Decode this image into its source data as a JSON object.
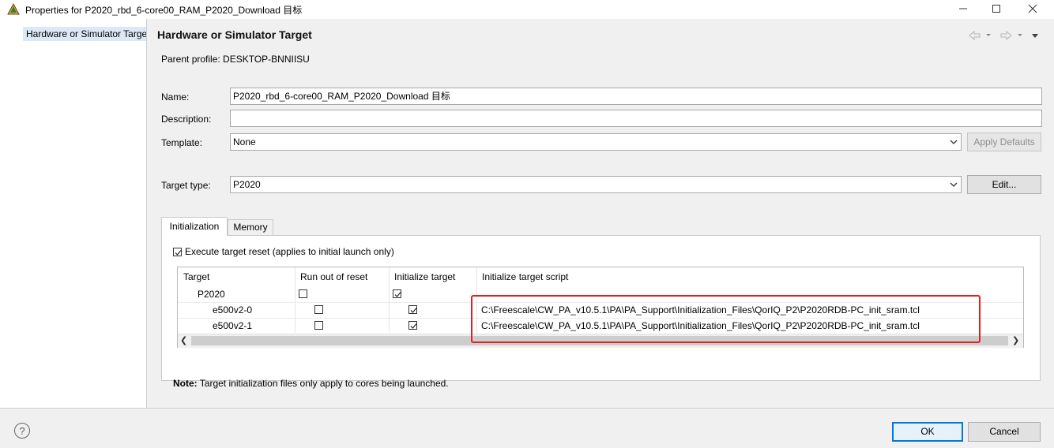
{
  "window": {
    "title": "Properties for P2020_rbd_6-core00_RAM_P2020_Download 目标",
    "min_glyph": "—",
    "max_glyph": "☐",
    "close_glyph": "✕"
  },
  "sidebar": {
    "items": [
      {
        "label": "Hardware or Simulator Target"
      }
    ]
  },
  "page": {
    "title": "Hardware or Simulator Target",
    "parent_profile": "Parent profile: DESKTOP-BNNIISU"
  },
  "form": {
    "name_label": "Name:",
    "name_value": "P2020_rbd_6-core00_RAM_P2020_Download 目标",
    "description_label": "Description:",
    "description_value": "",
    "template_label": "Template:",
    "template_value": "None",
    "apply_defaults_label": "Apply Defaults",
    "target_type_label": "Target type:",
    "target_type_value": "P2020",
    "edit_label": "Edit..."
  },
  "tabs": [
    {
      "label": "Initialization",
      "active": true
    },
    {
      "label": "Memory",
      "active": false
    }
  ],
  "init": {
    "execute_reset_label": "Execute target reset (applies to initial launch only)",
    "execute_reset_checked": true,
    "columns": [
      "Target",
      "Run out of reset",
      "Initialize target",
      "Initialize target script"
    ],
    "rows": [
      {
        "target": "P2020",
        "run_out_of_reset": false,
        "initialize": true,
        "script": ""
      },
      {
        "target": "e500v2-0",
        "run_out_of_reset": false,
        "initialize": true,
        "script": "C:\\Freescale\\CW_PA_v10.5.1\\PA\\PA_Support\\Initialization_Files\\QorIQ_P2\\P2020RDB-PC_init_sram.tcl"
      },
      {
        "target": "e500v2-1",
        "run_out_of_reset": false,
        "initialize": true,
        "script": "C:\\Freescale\\CW_PA_v10.5.1\\PA\\PA_Support\\Initialization_Files\\QorIQ_P2\\P2020RDB-PC_init_sram.tcl"
      }
    ],
    "note_bold": "Note:",
    "note_text": " Target initialization files only apply to cores being launched."
  },
  "footer": {
    "help_glyph": "?",
    "ok_label": "OK",
    "cancel_label": "Cancel"
  },
  "colors": {
    "annotation": "#e02020",
    "selection": "#dbe9f7",
    "ok_border": "#0078d7"
  }
}
